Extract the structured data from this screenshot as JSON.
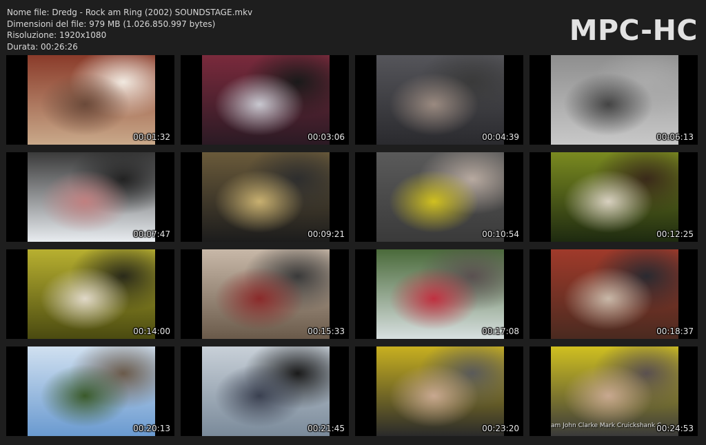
{
  "info": {
    "filename": "Nome file: Dredg - Rock am Ring (2002) SOUNDSTAGE.mkv",
    "filesize": "Dimensioni del file: 979 MB (1.026.850.997 bytes)",
    "resolution": "Risoluzione: 1920x1080",
    "duration": "Durata: 00:26:26"
  },
  "logo": "MPC-HC",
  "thumbnails": [
    {
      "time": "00:01:32",
      "scene": "guitarist-closeup",
      "colors": [
        "#c9a98a",
        "#8a3b2a",
        "#6b4a3a",
        "#f1e9e0"
      ]
    },
    {
      "time": "00:03:06",
      "scene": "singer-drums",
      "colors": [
        "#2b1a24",
        "#7a2a3c",
        "#c8c8d0",
        "#1a1a1a"
      ]
    },
    {
      "time": "00:04:39",
      "scene": "stage-crowd",
      "colors": [
        "#2a2a2e",
        "#55555a",
        "#9a8a80",
        "#3a3a3a"
      ]
    },
    {
      "time": "00:06:13",
      "scene": "stage-wide-day",
      "colors": [
        "#c8c8c8",
        "#8e8e8e",
        "#444",
        "#aaaaaa"
      ]
    },
    {
      "time": "00:07:47",
      "scene": "drummer-sky",
      "colors": [
        "#e8ecf0",
        "#3a3a3a",
        "#c08080",
        "#222"
      ]
    },
    {
      "time": "00:09:21",
      "scene": "band-stage-dark",
      "colors": [
        "#1c1c1c",
        "#6a5a3a",
        "#c8b070",
        "#2e2e2e"
      ]
    },
    {
      "time": "00:10:54",
      "scene": "singer-yellow-bar",
      "colors": [
        "#3a3a3a",
        "#5a5a5a",
        "#d0c020",
        "#b8aaa0"
      ]
    },
    {
      "time": "00:12:25",
      "scene": "guitarist-green-light",
      "colors": [
        "#1e2a10",
        "#7a8a20",
        "#d8d0c0",
        "#3a2a1a"
      ]
    },
    {
      "time": "00:14:00",
      "scene": "guitarist-yellow-glow",
      "colors": [
        "#4a4a10",
        "#b8b030",
        "#e0d8c8",
        "#2a2a1a"
      ]
    },
    {
      "time": "00:15:33",
      "scene": "crowd-closeup",
      "colors": [
        "#6a5a4a",
        "#c8b8a8",
        "#8a2a2a",
        "#3a3a3a"
      ]
    },
    {
      "time": "00:17:08",
      "scene": "stage-field",
      "colors": [
        "#d8e0e0",
        "#4a6a3a",
        "#c03040",
        "#5a5050"
      ]
    },
    {
      "time": "00:18:37",
      "scene": "bass-hands",
      "colors": [
        "#4a2a20",
        "#a03a2a",
        "#c8b8a8",
        "#2a2a30"
      ]
    },
    {
      "time": "00:20:13",
      "scene": "sky-crowd",
      "colors": [
        "#6a9ad0",
        "#d0e0f0",
        "#3a5a2a",
        "#6a5a4a"
      ]
    },
    {
      "time": "00:21:45",
      "scene": "scaffold-mic",
      "colors": [
        "#7a8a9a",
        "#c8d0d8",
        "#3a4050",
        "#1a1a1a"
      ]
    },
    {
      "time": "00:23:20",
      "scene": "singer-yellow-shirt",
      "colors": [
        "#2a2a2a",
        "#c8b020",
        "#c8a890",
        "#5a5a5a"
      ]
    },
    {
      "time": "00:24:53",
      "scene": "singer-credits",
      "colors": [
        "#3a3a3a",
        "#d0c020",
        "#c8a890",
        "#5a5050"
      ],
      "credit": "am  John Clarke  Mark Cruickshank  C"
    }
  ]
}
